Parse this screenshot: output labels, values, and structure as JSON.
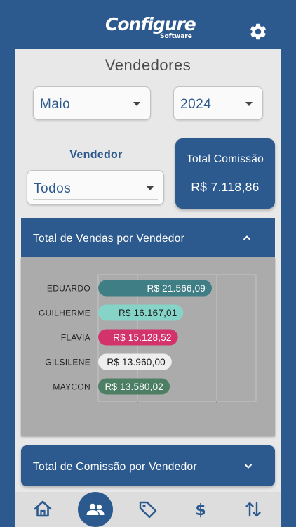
{
  "header": {
    "logo_main": "Configure",
    "logo_sub": "Software",
    "settings_icon": "gear-icon"
  },
  "page": {
    "title": "Vendedores"
  },
  "filters": {
    "month": "Maio",
    "year": "2024",
    "vendedor_label": "Vendedor",
    "vendedor_value": "Todos"
  },
  "total_comissao": {
    "label": "Total Comissão",
    "value": "R$ 7.118,86"
  },
  "sections": {
    "vendas_title": "Total de Vendas por Vendedor",
    "comissao_title": "Total de Comissão por Vendedor"
  },
  "chart_data": {
    "type": "bar",
    "orientation": "horizontal",
    "categories": [
      "EDUARDO",
      "GUILHERME",
      "FLAVIA",
      "GILSILENE",
      "MAYCON"
    ],
    "values": [
      21566.09,
      16167.01,
      15128.52,
      13960.0,
      13580.02
    ],
    "labels": [
      "R$ 21.566,09",
      "R$ 16.167,01",
      "R$ 15.128,52",
      "R$ 13.960,00",
      "R$ 13.580,02"
    ],
    "colors": [
      "#3f7e84",
      "#86d3c8",
      "#d2336b",
      "#eeeeee",
      "#4d7f65"
    ],
    "label_colors": [
      "#ffffff",
      "#1a1a1a",
      "#ffffff",
      "#1a1a1a",
      "#ffffff"
    ],
    "grid": true
  },
  "nav": {
    "items": [
      "home-icon",
      "users-icon",
      "tag-icon",
      "dollar-icon",
      "sort-arrows-icon"
    ],
    "active": "users-icon",
    "accent": "#2d5a8e"
  }
}
